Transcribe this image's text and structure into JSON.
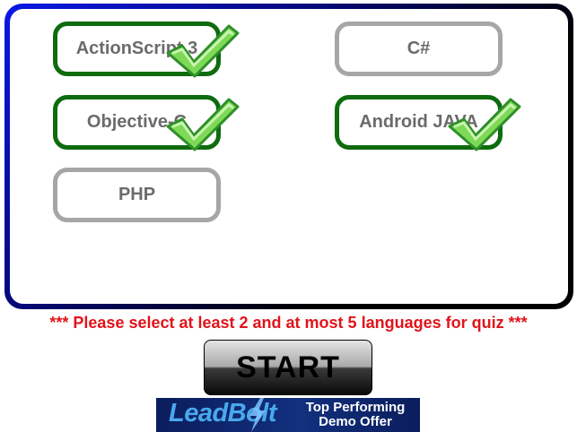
{
  "languages": [
    {
      "label": "ActionScript 3",
      "selected": true
    },
    {
      "label": "C#",
      "selected": false
    },
    {
      "label": "Objective-C",
      "selected": true
    },
    {
      "label": "Android JAVA",
      "selected": true
    },
    {
      "label": "PHP",
      "selected": false
    }
  ],
  "instruction": "*** Please select at least 2 and at most 5 languages for quiz ***",
  "start_label": "START",
  "ad": {
    "logo_text": "LeadBolt",
    "tagline_line1": "Top Performing",
    "tagline_line2": "Demo Offer"
  },
  "colors": {
    "selected_border": "#0e6b0e",
    "unselected_border": "#a6a6a6",
    "label_text": "#6b6b6b",
    "instruction_text": "#e0141a",
    "check_fill": "#7ed957"
  },
  "icons": {
    "check": "checkmark-icon",
    "ad_bolt": "lightning-bolt-icon"
  }
}
